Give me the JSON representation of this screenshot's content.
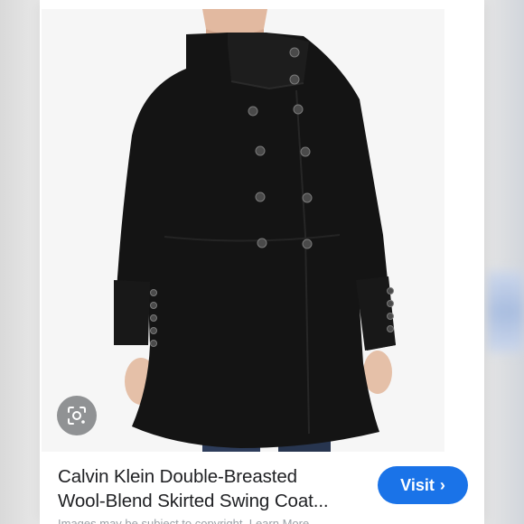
{
  "result": {
    "title_line1": "Calvin Klein Double-Breasted",
    "title_line2": "Wool-Blend Skirted Swing Coat...",
    "visit_label": "Visit",
    "disclaimer": "Images may be subject to copyright. Learn More"
  },
  "icons": {
    "lens": "google-lens-icon",
    "visit_chevron": "chevron-right-icon"
  },
  "colors": {
    "accent": "#1a73e8",
    "title": "#202124",
    "coat": "#141414"
  }
}
